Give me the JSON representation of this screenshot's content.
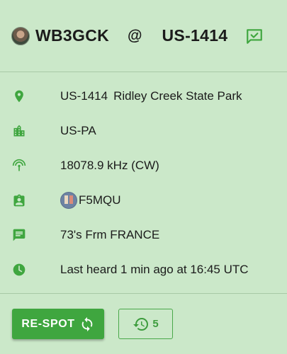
{
  "header": {
    "callsign": "WB3GCK",
    "at": "@",
    "park_ref": "US-1414",
    "icons": {
      "avatar": "operator-avatar",
      "status": "spot-check-icon"
    }
  },
  "details": {
    "park_ref": "US-1414",
    "park_name": "Ridley Creek State Park",
    "location": "US-PA",
    "frequency": "18078.9 kHz (CW)",
    "spotter": "F5MQU",
    "comment": "73's Frm FRANCE",
    "last_heard": "Last heard 1 min ago at 16:45 UTC"
  },
  "actions": {
    "respot_label": "RE-SPOT",
    "history_count": "5"
  },
  "colors": {
    "background": "#cbe8c9",
    "accent": "#3fa63f",
    "text": "#1b1b1b"
  }
}
